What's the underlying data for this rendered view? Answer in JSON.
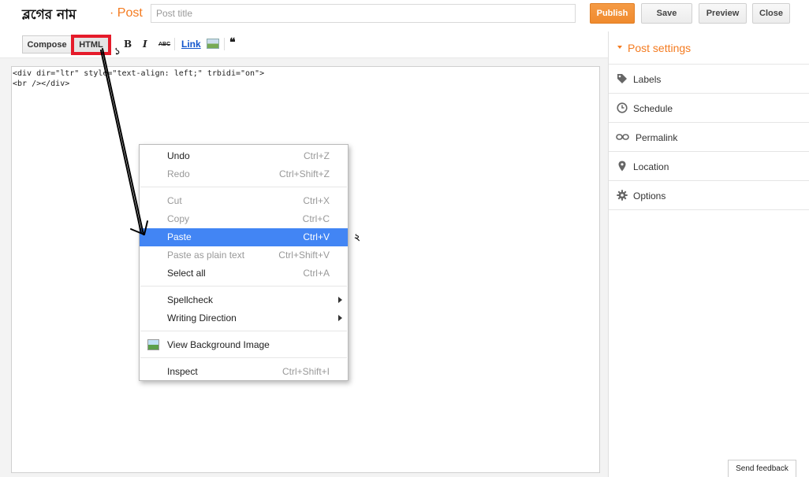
{
  "header": {
    "blog_name": "ব্লগের নাম",
    "breadcrumb": "· Post",
    "title_placeholder": "Post title",
    "publish_label": "Publish",
    "save_label": "Save",
    "preview_label": "Preview",
    "close_label": "Close"
  },
  "toolbar": {
    "compose_label": "Compose",
    "html_label": "HTML",
    "bold": "B",
    "italic": "I",
    "strike": "ABC",
    "link": "Link",
    "quote": "❝",
    "image_icon": "image-icon"
  },
  "editor": {
    "content": "<div dir=\"ltr\" style=\"text-align: left;\" trbidi=\"on\">\n<br /></div>"
  },
  "sidebar": {
    "title": "Post settings",
    "items": [
      {
        "label": "Labels",
        "icon": "tag-icon"
      },
      {
        "label": "Schedule",
        "icon": "clock-icon"
      },
      {
        "label": "Permalink",
        "icon": "link-icon"
      },
      {
        "label": "Location",
        "icon": "pin-icon"
      },
      {
        "label": "Options",
        "icon": "gear-icon"
      }
    ]
  },
  "context_menu": {
    "items": [
      {
        "label": "Undo",
        "shortcut": "Ctrl+Z"
      },
      {
        "label": "Redo",
        "shortcut": "Ctrl+Shift+Z"
      },
      {
        "label": "Cut",
        "shortcut": "Ctrl+X"
      },
      {
        "label": "Copy",
        "shortcut": "Ctrl+C"
      },
      {
        "label": "Paste",
        "shortcut": "Ctrl+V"
      },
      {
        "label": "Paste as plain text",
        "shortcut": "Ctrl+Shift+V"
      },
      {
        "label": "Select all",
        "shortcut": "Ctrl+A"
      },
      {
        "label": "Spellcheck"
      },
      {
        "label": "Writing Direction"
      },
      {
        "label": "View Background Image"
      },
      {
        "label": "Inspect",
        "shortcut": "Ctrl+Shift+I"
      }
    ]
  },
  "annotations": {
    "step_one": "১",
    "step_two": "২"
  },
  "feedback_label": "Send feedback",
  "colors": {
    "accent_orange": "#f47b20",
    "highlight_blue": "#4285f4",
    "annotation_red": "#e51b2a"
  }
}
